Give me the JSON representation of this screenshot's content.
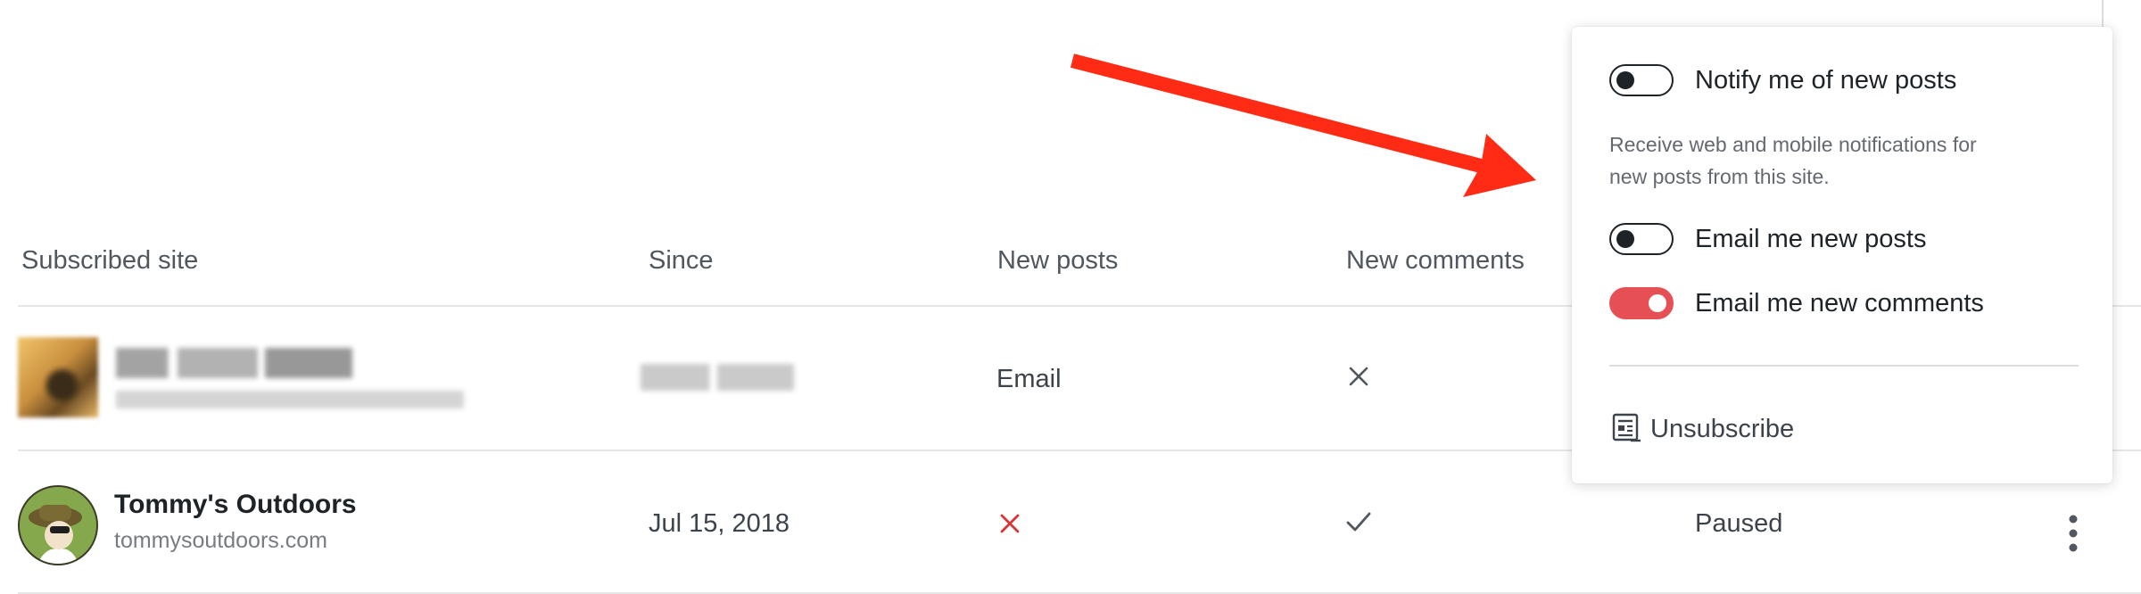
{
  "table": {
    "headers": {
      "site": "Subscribed site",
      "since": "Since",
      "new_posts": "New posts",
      "new_comments": "New comments"
    },
    "rows": [
      {
        "site_name": "",
        "site_url": "",
        "since": "",
        "new_posts": "Email",
        "new_comments_icon": "x-icon",
        "blurred": true
      },
      {
        "site_name": "Tommy's Outdoors",
        "site_url": "tommysoutdoors.com",
        "since": "Jul 15, 2018",
        "new_posts_icon": "x-icon",
        "new_comments_icon": "check-icon",
        "status": "Paused"
      }
    ]
  },
  "popover": {
    "notify_new_posts": {
      "label": "Notify me of new posts",
      "on": false
    },
    "notify_help": "Receive web and mobile notifications for new posts from this site.",
    "email_new_posts": {
      "label": "Email me new posts",
      "on": false
    },
    "email_new_comments": {
      "label": "Email me new comments",
      "on": true
    },
    "unsubscribe_label": "Unsubscribe"
  },
  "colors": {
    "accent": "#e65054",
    "arrow": "#ff2b14",
    "x_red": "#d63638"
  }
}
